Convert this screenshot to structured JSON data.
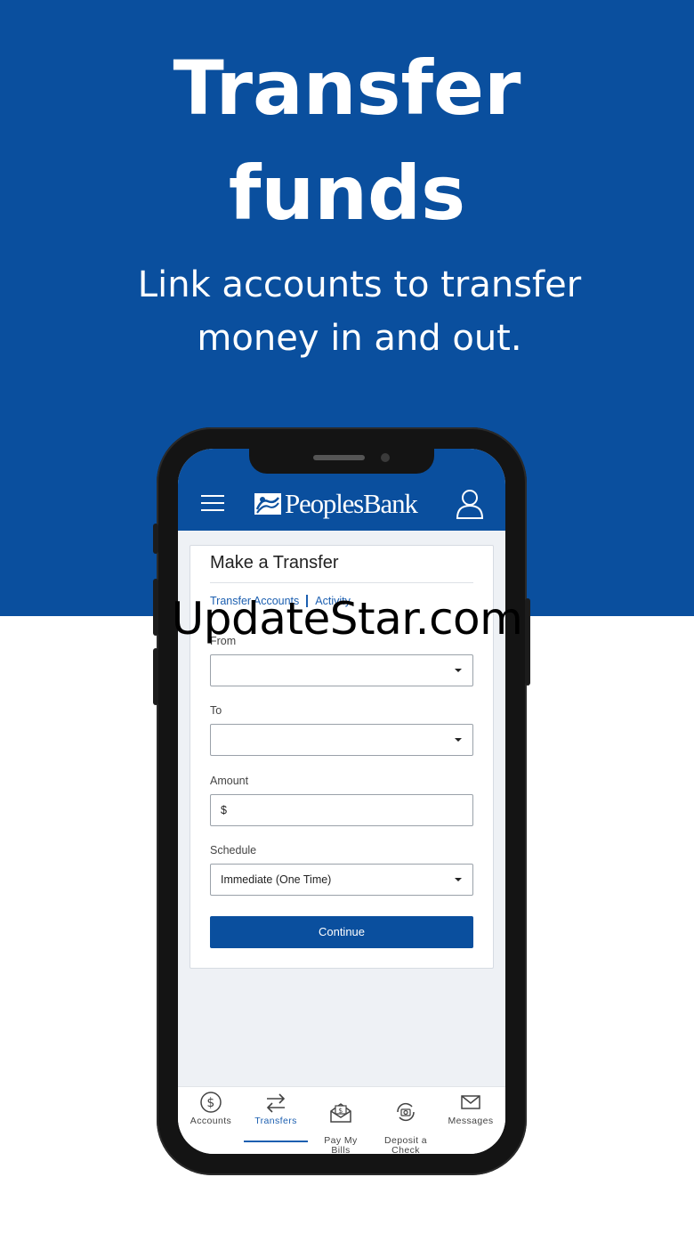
{
  "hero": {
    "title": "Transfer\nfunds",
    "subtitle": "Link accounts to transfer\nmoney in and out."
  },
  "app": {
    "brand": "PeoplesBank",
    "icons": {
      "menu": "hamburger-menu-icon",
      "profile": "user-profile-icon"
    }
  },
  "form": {
    "title": "Make a Transfer",
    "nav": {
      "transfer_accounts": "Transfer Accounts",
      "activity": "Activity"
    },
    "fields": {
      "from_label": "From",
      "from_value": "",
      "to_label": "To",
      "to_value": "",
      "amount_label": "Amount",
      "amount_value": "$",
      "schedule_label": "Schedule",
      "schedule_value": "Immediate (One Time)"
    },
    "continue_label": "Continue"
  },
  "tabbar": {
    "items": [
      {
        "label": "Accounts",
        "icon": "dollar-circle-icon"
      },
      {
        "label": "Transfers",
        "icon": "transfer-arrows-icon",
        "active": true
      },
      {
        "label": "Pay My\nBills",
        "icon": "envelope-bill-icon"
      },
      {
        "label": "Deposit a\nCheck",
        "icon": "camera-deposit-icon"
      },
      {
        "label": "Messages",
        "icon": "mail-icon"
      }
    ]
  },
  "watermark": "UpdateStar.com",
  "colors": {
    "brand_blue": "#0a4f9e",
    "link_blue": "#1c5fb0"
  }
}
